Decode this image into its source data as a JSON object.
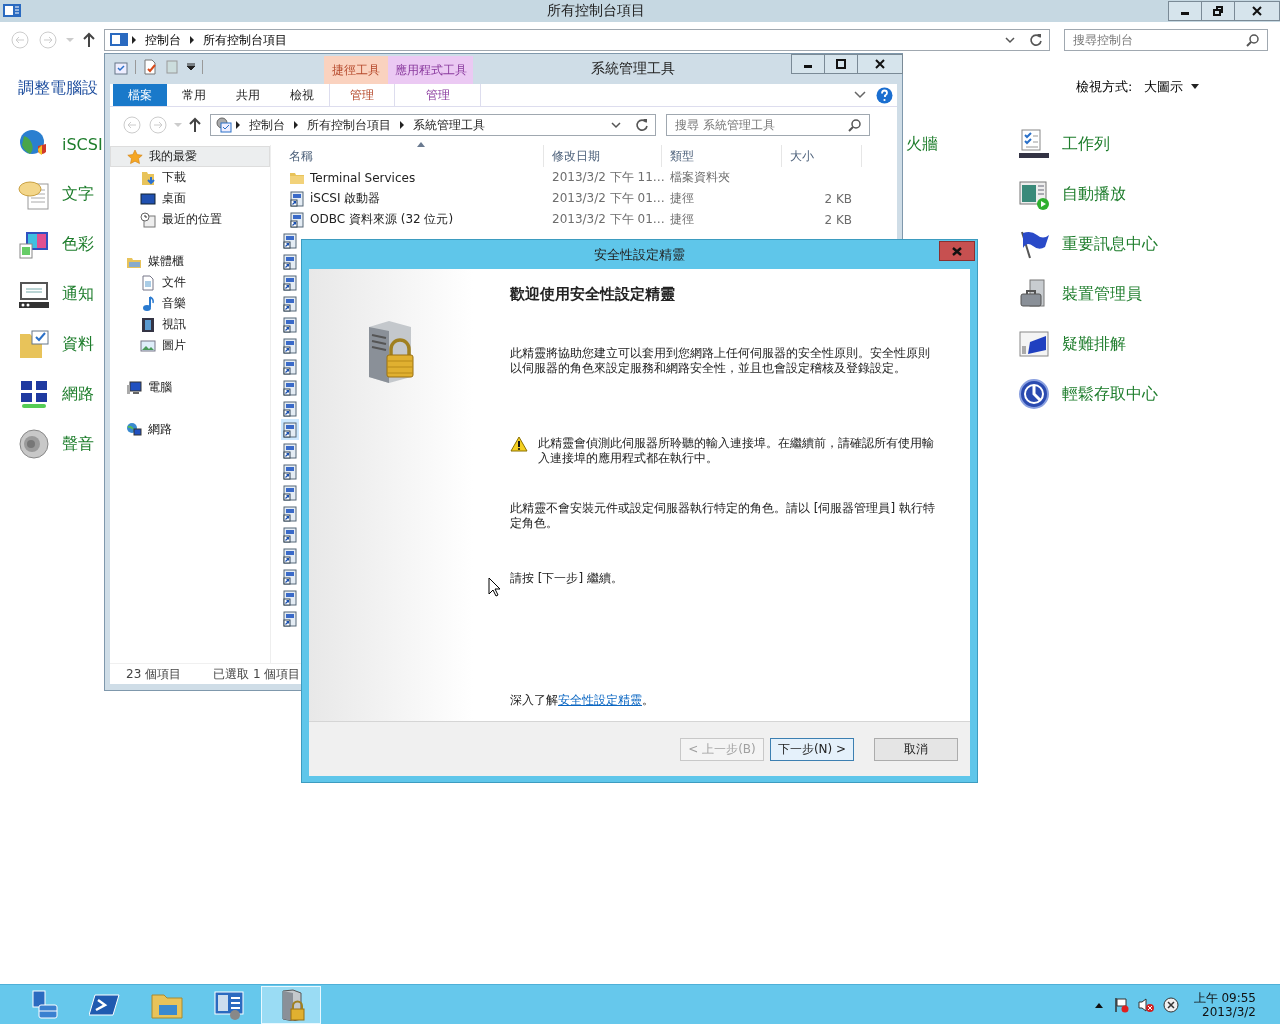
{
  "control_panel": {
    "title": "所有控制台項目",
    "address": [
      "控制台",
      "所有控制台項目"
    ],
    "search": {
      "placeholder": "搜尋控制台"
    },
    "heading": "調整電腦設",
    "view_label": "檢視方式:",
    "view_value": "大圖示",
    "columns": [
      [
        {
          "kind": "globe",
          "label": "iSCSI"
        },
        {
          "kind": "speech",
          "label": "文字"
        },
        {
          "kind": "color",
          "label": "色彩"
        },
        {
          "kind": "notify",
          "label": "通知"
        },
        {
          "kind": "folder",
          "label": "資料"
        },
        {
          "kind": "network",
          "label": "網路"
        },
        {
          "kind": "sound",
          "label": "聲音"
        }
      ],
      [
        {
          "kind": "none",
          "label": "火牆"
        }
      ],
      [
        {
          "kind": "checklist",
          "label": "工作列"
        },
        {
          "kind": "autoplay",
          "label": "自動播放"
        },
        {
          "kind": "flag",
          "label": "重要訊息中心"
        },
        {
          "kind": "devices",
          "label": "裝置管理員"
        },
        {
          "kind": "troubleshoot",
          "label": "疑難排解"
        },
        {
          "kind": "access",
          "label": "輕鬆存取中心"
        }
      ]
    ]
  },
  "explorer": {
    "title": "系統管理工具",
    "tabs": [
      {
        "label": "檔案",
        "kind": "file"
      },
      {
        "label": "常用",
        "kind": "tab"
      },
      {
        "label": "共用",
        "kind": "tab"
      },
      {
        "label": "檢視",
        "kind": "tab"
      }
    ],
    "context_groups": [
      {
        "label": "捷徑工具",
        "color": "#fad2bf",
        "tab": "管理"
      },
      {
        "label": "應用程式工具",
        "color": "#ebc9f3",
        "tab": "管理"
      }
    ],
    "address": [
      "控制台",
      "所有控制台項目",
      "系統管理工具"
    ],
    "search": {
      "placeholder": "搜尋 系統管理工具"
    },
    "nav": [
      {
        "kind": "star",
        "label": "我的最愛",
        "selected": true,
        "children": [
          {
            "kind": "download",
            "label": "下載",
            "selected": false
          },
          {
            "kind": "desktop",
            "label": "桌面",
            "selected": false
          },
          {
            "kind": "recent",
            "label": "最近的位置",
            "selected": false
          }
        ]
      },
      {
        "kind": "library",
        "label": "媒體櫃",
        "selected": false,
        "children": [
          {
            "kind": "document",
            "label": "文件",
            "selected": false
          },
          {
            "kind": "music",
            "label": "音樂",
            "selected": false
          },
          {
            "kind": "video",
            "label": "視訊",
            "selected": false
          },
          {
            "kind": "picture",
            "label": "圖片",
            "selected": false
          }
        ]
      },
      {
        "kind": "computer",
        "label": "電腦",
        "selected": false
      },
      {
        "kind": "network",
        "label": "網路",
        "selected": false
      }
    ],
    "columns": [
      "名稱",
      "修改日期",
      "類型",
      "大小"
    ],
    "rows": [
      {
        "kind": "folder",
        "name": "Terminal Services",
        "date": "2013/3/2 下午 11…",
        "type": "檔案資料夾",
        "selected": false
      },
      {
        "kind": "shortcut",
        "name": "iSCSI 啟動器",
        "date": "2013/3/2 下午 01…",
        "type": "捷徑",
        "size": "2 KB",
        "selected": false
      },
      {
        "kind": "shortcut",
        "name": "ODBC 資料來源 (32 位元)",
        "date": "2013/3/2 下午 01…",
        "type": "捷徑",
        "size": "2 KB",
        "selected": false
      }
    ],
    "covered_rows": [
      {
        "selected": false
      },
      {
        "selected": false
      },
      {
        "selected": false
      },
      {
        "selected": false
      },
      {
        "selected": false
      },
      {
        "selected": false
      },
      {
        "selected": false
      },
      {
        "selected": false
      },
      {
        "selected": false
      },
      {
        "selected": true
      },
      {
        "selected": false
      },
      {
        "selected": false
      },
      {
        "selected": false
      },
      {
        "selected": false
      },
      {
        "selected": false
      },
      {
        "selected": false
      },
      {
        "selected": false
      },
      {
        "selected": false
      },
      {
        "selected": false
      }
    ],
    "status": [
      "23 個項目",
      "已選取 1 個項目"
    ]
  },
  "wizard": {
    "title": "安全性設定精靈",
    "heading": "歡迎使用安全性設定精靈",
    "paragraphs": [
      {
        "kind": "text",
        "text": "此精靈將協助您建立可以套用到您網路上任何伺服器的安全性原則。安全性原則以伺服器的角色來設定服務和網路安全性，並且也會設定稽核及登錄設定。"
      },
      {
        "kind": "warning",
        "text": "此精靈會偵測此伺服器所聆聽的輸入連接埠。在繼續前，請確認所有使用輸入連接埠的應用程式都在執行中。"
      },
      {
        "kind": "text",
        "text": "此精靈不會安裝元件或設定伺服器執行特定的角色。請以 [伺服器管理員] 執行特定角色。"
      },
      {
        "kind": "text",
        "text": "請按 [下一步] 繼續。"
      }
    ],
    "learn_more": {
      "text": "深入了解",
      "link": "安全性設定精靈",
      "after": "。"
    },
    "buttons": [
      {
        "label": "< 上一步(B)",
        "disabled": true,
        "default": false
      },
      {
        "label": "下一步(N) >",
        "disabled": false,
        "default": true
      },
      {
        "label": "取消",
        "disabled": false,
        "default": false
      }
    ]
  },
  "taskbar": {
    "apps": [
      {
        "kind": "server",
        "selected": false
      },
      {
        "kind": "shell",
        "selected": false
      },
      {
        "kind": "folder",
        "selected": false
      },
      {
        "kind": "panel",
        "selected": false
      },
      {
        "kind": "lock-server",
        "selected": true
      }
    ],
    "time": "上午 09:55",
    "date": "2013/3/2"
  }
}
